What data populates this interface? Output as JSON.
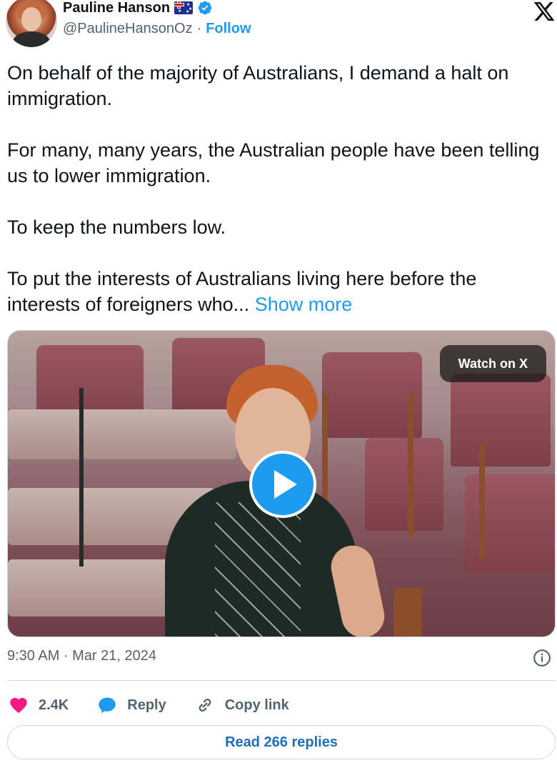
{
  "author": {
    "display_name": "Pauline Hanson",
    "handle": "@PaulineHansonOz",
    "separator": "·",
    "follow_label": "Follow",
    "flag_icon": "australian-flag-icon",
    "verified_icon": "verified-badge-icon"
  },
  "platform_icon": "x-logo-icon",
  "tweet": {
    "paragraphs": [
      "On behalf of the majority of Australians, I demand a halt on immigration.",
      "For many, many years, the Australian people have been telling us to lower immigration.",
      "To keep the numbers low.",
      "To put the interests of Australians living here before the interests of foreigners who..."
    ],
    "show_more_label": "Show more"
  },
  "media": {
    "watch_label": "Watch on X",
    "play_icon": "play-icon"
  },
  "meta": {
    "timestamp": "9:30 AM · Mar 21, 2024",
    "info_icon": "info-icon"
  },
  "actions": {
    "like_count": "2.4K",
    "reply_label": "Reply",
    "copy_link_label": "Copy link"
  },
  "read_replies_label": "Read 266 replies",
  "colors": {
    "accent": "#1d9bf0",
    "like": "#f91880",
    "text": "#0f1419",
    "muted": "#536471",
    "border": "#cfd9de"
  }
}
